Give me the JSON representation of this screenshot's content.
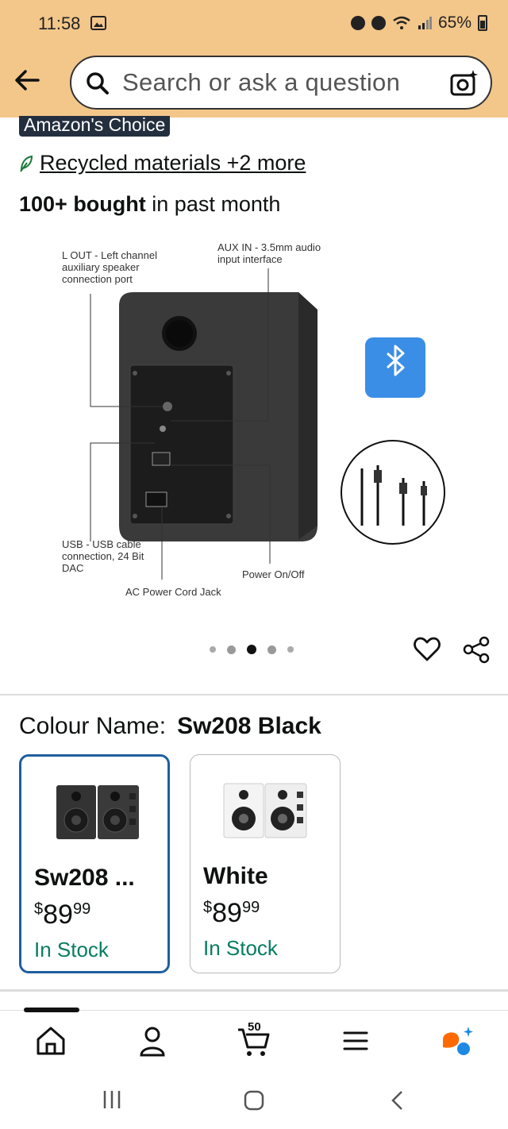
{
  "status_bar": {
    "time": "11:58",
    "battery": "65%"
  },
  "header": {
    "search_placeholder": "Search or ask a question"
  },
  "badge": {
    "choice": "Amazon's Choice"
  },
  "sustainability": {
    "link_text": "Recycled materials +2 more"
  },
  "purchase_stats": {
    "bold": "100+ bought",
    "rest": " in past month"
  },
  "product_image": {
    "callouts": {
      "lout": "L OUT  -  Left channel auxiliary speaker connection port",
      "auxin": "AUX IN  -  3.5mm audio input interface",
      "usb": "USB - USB cable connection, 24 Bit DAC",
      "power": "Power On/Off",
      "ac": "AC Power Cord Jack"
    },
    "carousel": {
      "count": 5,
      "active_index": 2
    }
  },
  "colour": {
    "label": "Colour Name:",
    "selected_value": "Sw208 Black",
    "options": [
      {
        "name": "Sw208 ...",
        "currency": "$",
        "price_whole": "89",
        "price_cents": "99",
        "stock": "In Stock",
        "selected": true
      },
      {
        "name": "White",
        "currency": "$",
        "price_whole": "89",
        "price_cents": "99",
        "stock": "In Stock",
        "selected": false
      }
    ]
  },
  "bottom_nav": {
    "cart_count": "50",
    "items": [
      "home-icon",
      "account-icon",
      "cart-icon",
      "menu-icon",
      "rufus-icon"
    ]
  },
  "colors": {
    "header_bg": "#f3c68a",
    "stock_green": "#067d62",
    "selected_border": "#1f5f9e"
  }
}
